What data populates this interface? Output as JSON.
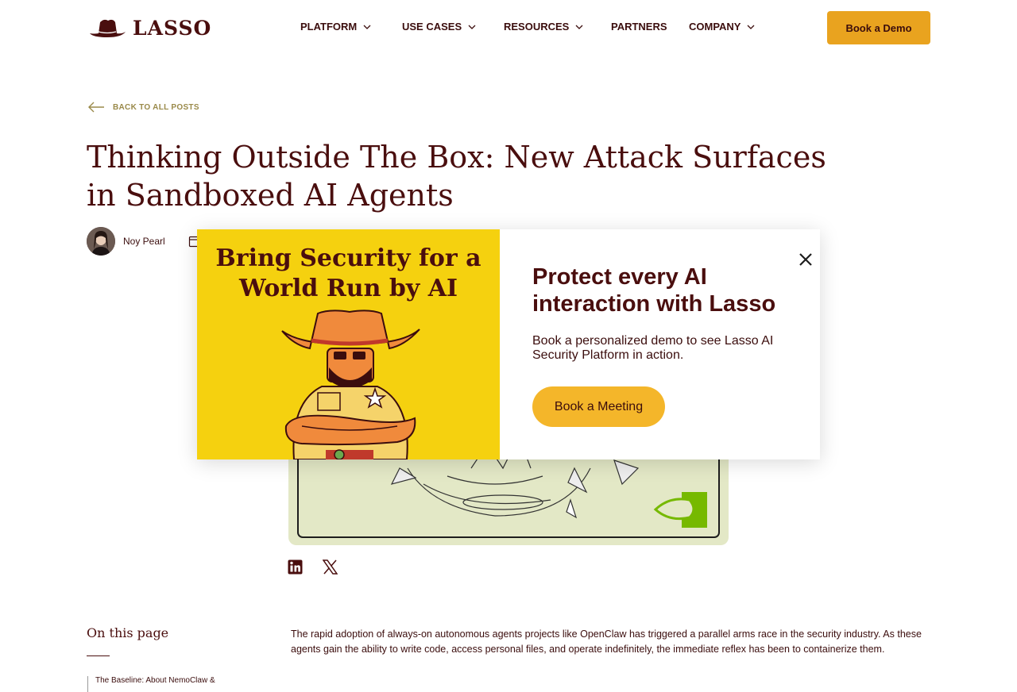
{
  "brand": {
    "name": "LASSO",
    "logo_icon": "cowboy-hat-icon"
  },
  "nav": {
    "items": [
      {
        "label": "PLATFORM",
        "has_dropdown": true
      },
      {
        "label": "USE CASES",
        "has_dropdown": true
      },
      {
        "label": "RESOURCES",
        "has_dropdown": true
      },
      {
        "label": "PARTNERS",
        "has_dropdown": false
      },
      {
        "label": "COMPANY",
        "has_dropdown": true
      }
    ],
    "cta": "Book a Demo"
  },
  "article": {
    "back_label": "BACK TO ALL POSTS",
    "title": "Thinking Outside The Box: New Attack Surfaces in Sandboxed AI Agents",
    "author": "Noy Pearl",
    "toc_title": "On this page",
    "toc_items": [
      "The Baseline: About NemoClaw &"
    ],
    "intro": "The rapid adoption of always-on autonomous agents projects like OpenClaw has triggered a parallel arms race in the security industry. As these agents gain the ability to write code, access personal files, and operate indefinitely, the immediate reflex has been to containerize them.",
    "share": [
      "linkedin-icon",
      "x-icon"
    ]
  },
  "modal": {
    "promo": "Bring Security for a World Run by AI",
    "title": "Protect every AI interaction with Lasso",
    "subtitle": "Book a personalized demo to see Lasso AI Security Platform in action.",
    "button": "Book a Meeting",
    "close_icon": "close-icon"
  },
  "colors": {
    "brand": "#4a0e0e",
    "accent": "#e9a31f",
    "promo_bg": "#f5d10f"
  }
}
